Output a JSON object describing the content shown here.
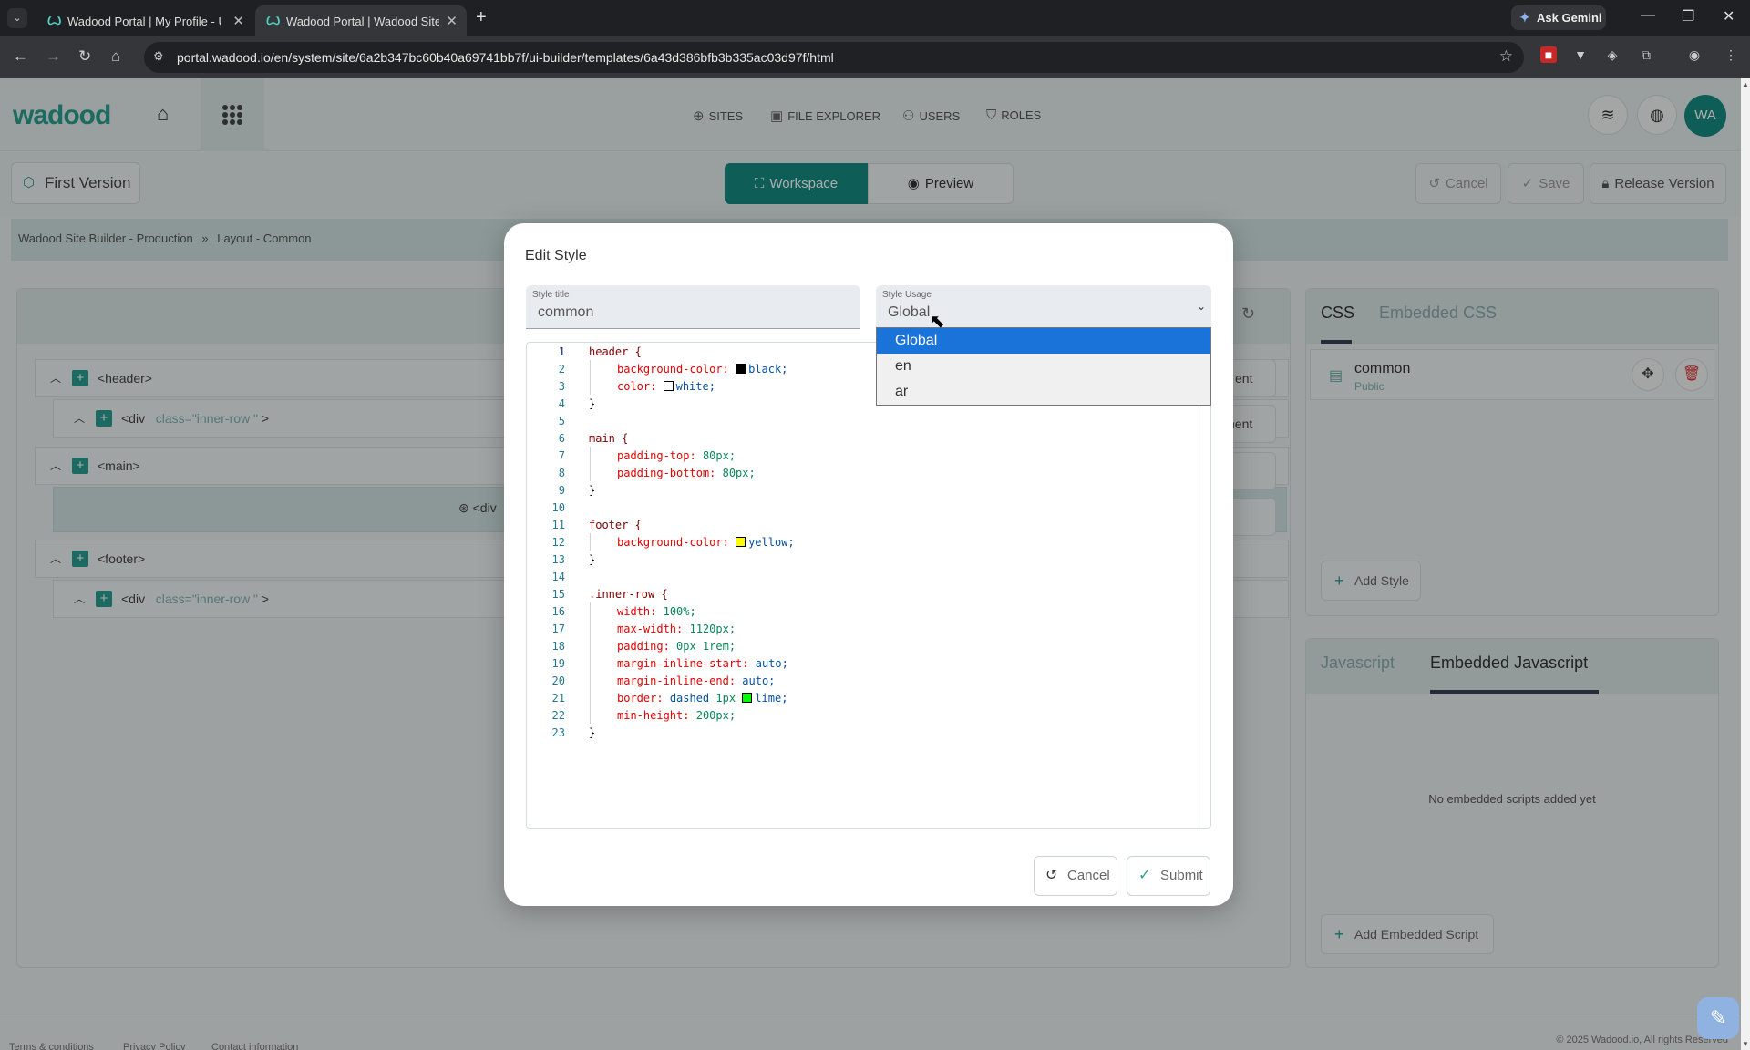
{
  "browser": {
    "tabs": [
      {
        "title": "Wadood Portal | My Profile - U"
      },
      {
        "title": "Wadood Portal | Wadood Site B"
      }
    ],
    "ask_gemini": "Ask Gemini",
    "url": "portal.wadood.io/en/system/site/6a2b347bc60b40a69741bb7f/ui-builder/templates/6a43d386bfb3b335ac03d97f/html"
  },
  "header": {
    "logo": "wadood",
    "nav": [
      {
        "label": "SITES",
        "icon": "globe-icon"
      },
      {
        "label": "FILE EXPLORER",
        "icon": "images-icon"
      },
      {
        "label": "USERS",
        "icon": "users-icon"
      },
      {
        "label": "ROLES",
        "icon": "shield-icon"
      }
    ],
    "avatar": "WA"
  },
  "toolbar": {
    "version": "First Version",
    "workspace": "Workspace",
    "preview": "Preview",
    "cancel": "Cancel",
    "save": "Save",
    "release": "Release Version"
  },
  "breadcrumb": [
    "Wadood Site Builder - Production",
    "»",
    "Layout - Common"
  ],
  "tree": {
    "header": "<header>",
    "header_div": "<div",
    "header_div_class": "class=\"inner-row \"",
    "header_div_end": ">",
    "main": "<main>",
    "main_div": "<div",
    "footer": "<footer>",
    "footer_div": "<div",
    "footer_div_class": "class=\"inner-row \"",
    "footer_div_end": ">",
    "side_labels": [
      "ent",
      "nent"
    ]
  },
  "css_panel": {
    "tabs": [
      "CSS",
      "Embedded CSS"
    ],
    "style_name": "common",
    "style_visibility": "Public",
    "add_style": "Add Style"
  },
  "js_panel": {
    "tabs": [
      "Javascript",
      "Embedded Javascript"
    ],
    "empty": "No embedded scripts added yet",
    "add_script": "Add Embedded Script"
  },
  "footer": {
    "links": [
      "Terms & conditions",
      "Privacy Policy",
      "Contact information"
    ],
    "copyright": "© 2025 Wadood.io, All rights Reserved"
  },
  "modal": {
    "title": "Edit Style",
    "style_title_label": "Style title",
    "style_title_value": "common",
    "usage_label": "Style Usage",
    "usage_value": "Global",
    "usage_options": [
      "Global",
      "en",
      "ar"
    ],
    "cancel": "Cancel",
    "submit": "Submit",
    "colors": {
      "black": "#000000",
      "white": "#ffffff",
      "yellow": "#ffff00",
      "lime": "#00ff00"
    },
    "code": {
      "l1": "header {",
      "l2_p": "background-color:",
      "l2_v": "black;",
      "l3_p": "color:",
      "l3_v": "white;",
      "l4": "}",
      "l6": "main {",
      "l7_p": "padding-top:",
      "l7_v": "80px;",
      "l8_p": "padding-bottom:",
      "l8_v": "80px;",
      "l9": "}",
      "l11": "footer {",
      "l12_p": "background-color:",
      "l12_v": "yellow;",
      "l13": "}",
      "l15": ".inner-row {",
      "l16_p": "width:",
      "l16_v": "100%;",
      "l17_p": "max-width:",
      "l17_v": "1120px;",
      "l18_p": "padding:",
      "l18_v": "0px 1rem;",
      "l19_p": "margin-inline-start:",
      "l19_v": "auto;",
      "l20_p": "margin-inline-end:",
      "l20_v": "auto;",
      "l21_p": "border:",
      "l21_v1": "dashed",
      "l21_v2": "1px",
      "l21_v3": "lime;",
      "l22_p": "min-height:",
      "l22_v": "200px;",
      "l23": "}"
    }
  }
}
